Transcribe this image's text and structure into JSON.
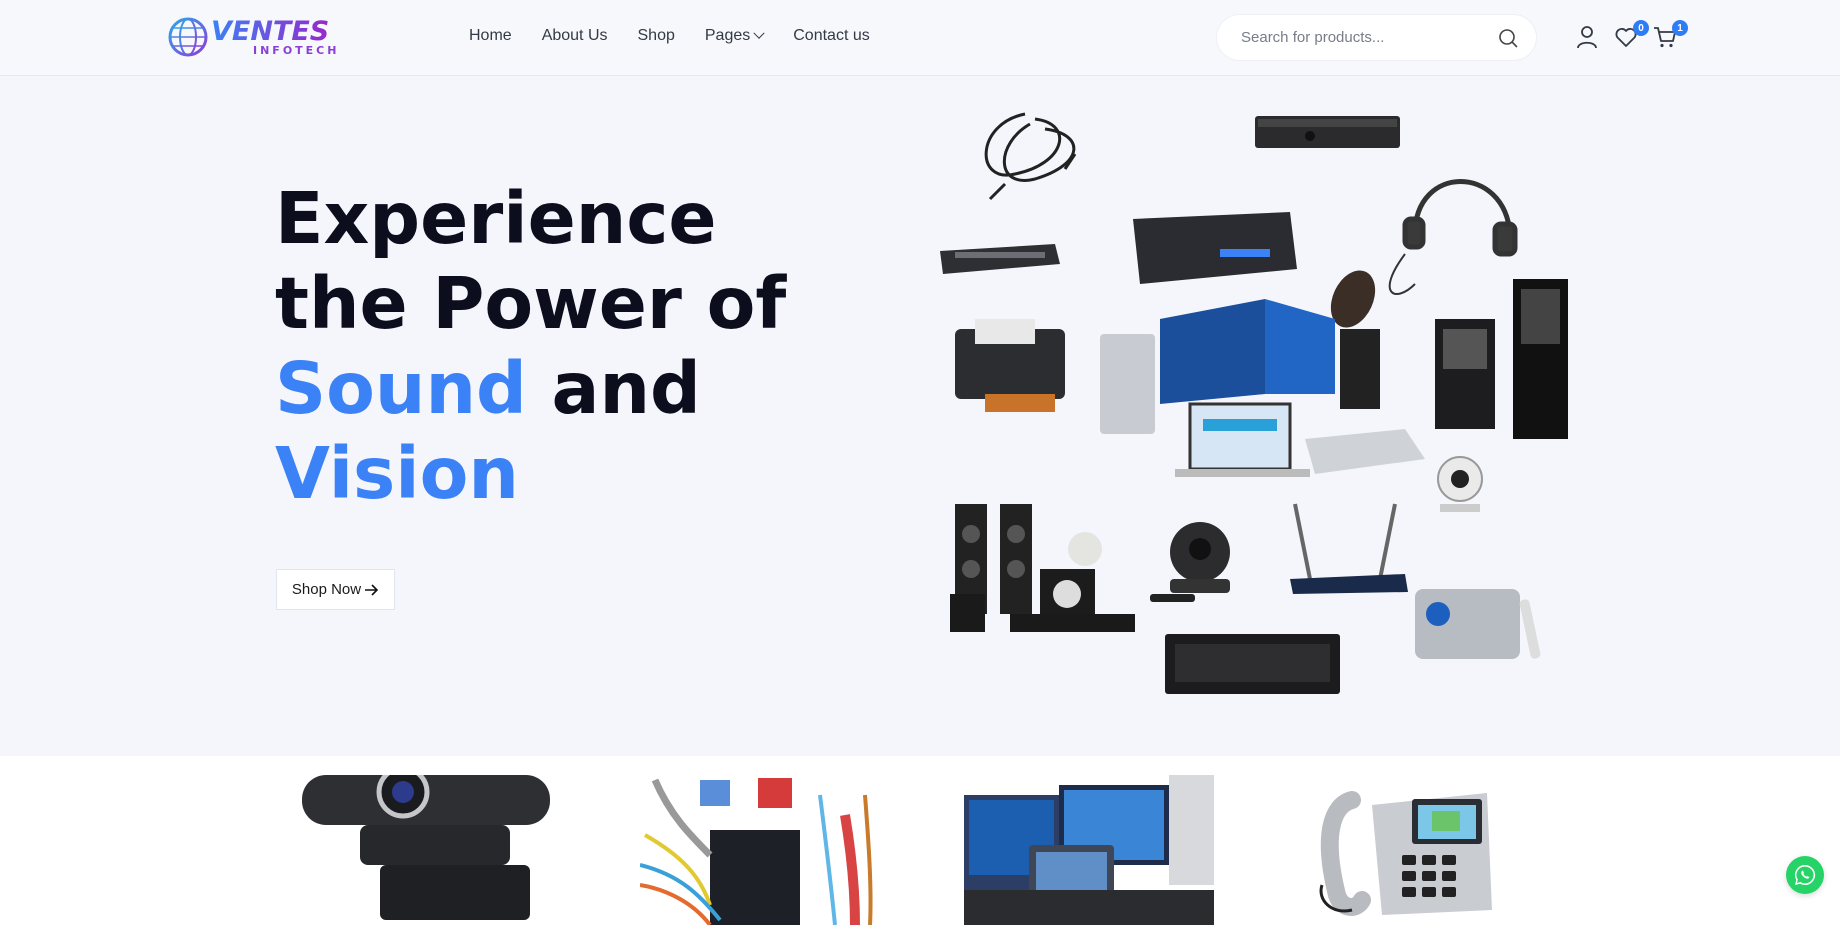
{
  "header": {
    "logo": {
      "line1": "VENTES",
      "line2": "INFOTECH"
    },
    "nav": [
      {
        "label": "Home"
      },
      {
        "label": "About Us"
      },
      {
        "label": "Shop"
      },
      {
        "label": "Pages"
      },
      {
        "label": "Contact us"
      }
    ],
    "search": {
      "placeholder": "Search for products..."
    },
    "wishlist_count": "0",
    "cart_count": "1"
  },
  "hero": {
    "line1": "Experience",
    "line2": "the Power of",
    "line3_blue": "Sound",
    "line3_rest": " and",
    "line4_blue": "Vision",
    "button_label": "Shop Now",
    "accent_color": "#3b82f6"
  },
  "categories": [
    {
      "icon": "webcam"
    },
    {
      "icon": "network-cables"
    },
    {
      "icon": "computers"
    },
    {
      "icon": "ip-phone"
    }
  ],
  "floating": {
    "whatsapp_icon": "whatsapp-icon"
  }
}
